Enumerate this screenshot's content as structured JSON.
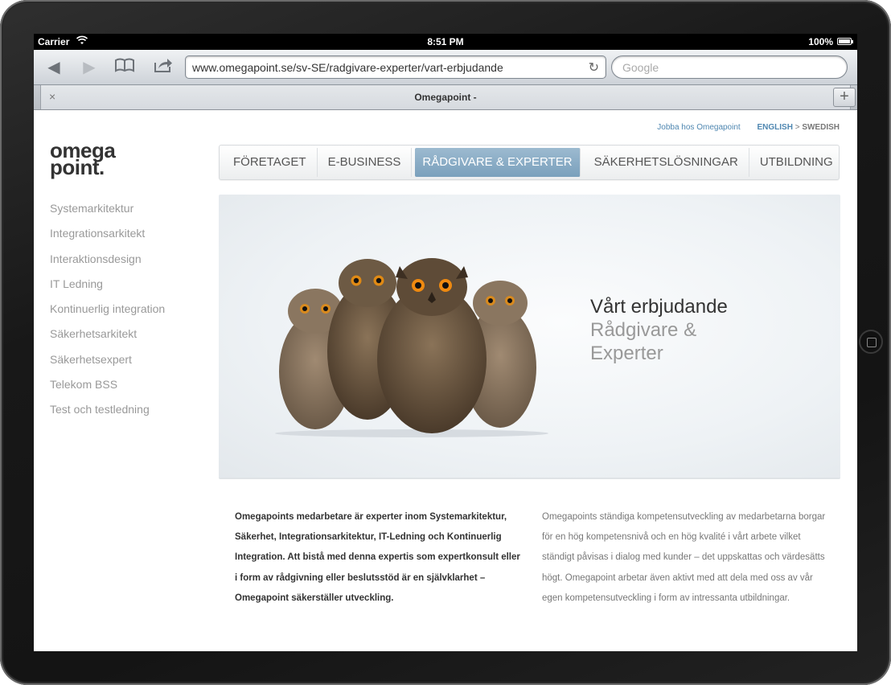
{
  "status_bar": {
    "carrier": "Carrier",
    "time": "8:51 PM",
    "battery": "100%"
  },
  "browser": {
    "url": "www.omegapoint.se/sv-SE/radgivare-experter/vart-erbjudande",
    "search_placeholder": "Google",
    "tab_title": "Omegapoint -",
    "tab_close": "×",
    "tab_add": "+"
  },
  "site": {
    "top_links": {
      "jobba": "Jobba hos Omegapoint",
      "english": "ENGLISH",
      "separator": " > ",
      "swedish": "SWEDISH"
    },
    "logo": {
      "line1": "omega",
      "line2": "point."
    },
    "nav": [
      {
        "label": "FÖRETAGET"
      },
      {
        "label": "E-BUSINESS"
      },
      {
        "label": "RÅDGIVARE & EXPERTER"
      },
      {
        "label": "SÄKERHETSLÖSNINGAR"
      },
      {
        "label": "UTBILDNING"
      }
    ],
    "sidebar": [
      {
        "label": "Systemarkitektur"
      },
      {
        "label": "Integrationsarkitekt"
      },
      {
        "label": "Interaktionsdesign"
      },
      {
        "label": "IT Ledning"
      },
      {
        "label": "Kontinuerlig integration"
      },
      {
        "label": "Säkerhetsarkitekt"
      },
      {
        "label": "Säkerhetsexpert"
      },
      {
        "label": "Telekom BSS"
      },
      {
        "label": "Test och testledning"
      }
    ],
    "hero": {
      "heading": "Vårt erbjudande",
      "subheading_line1": "Rådgivare &",
      "subheading_line2": "Experter"
    },
    "intro_left": "Omegapoints medarbetare är experter inom Systemarkitektur, Säkerhet, Integrationsarkitektur, IT-Ledning och Kontinuerlig Integration. Att bistå med denna expertis som expertkonsult eller i form av rådgivning eller beslutsstöd är en självklarhet – Omegapoint säkerställer utveckling.",
    "intro_right": "Omegapoints ständiga kompetensutveckling av medarbetarna borgar för en hög kompetensnivå och en hög kvalité i vårt arbete vilket ständigt påvisas i dialog med kunder – det uppskattas och värdesätts högt. Omegapoint arbetar även aktivt med att dela med oss av vår egen kompetensutveckling i form av intressanta utbildningar."
  },
  "colors": {
    "accent": "#7aa0bc",
    "link": "#4f87b1",
    "muted_text": "#999999"
  }
}
